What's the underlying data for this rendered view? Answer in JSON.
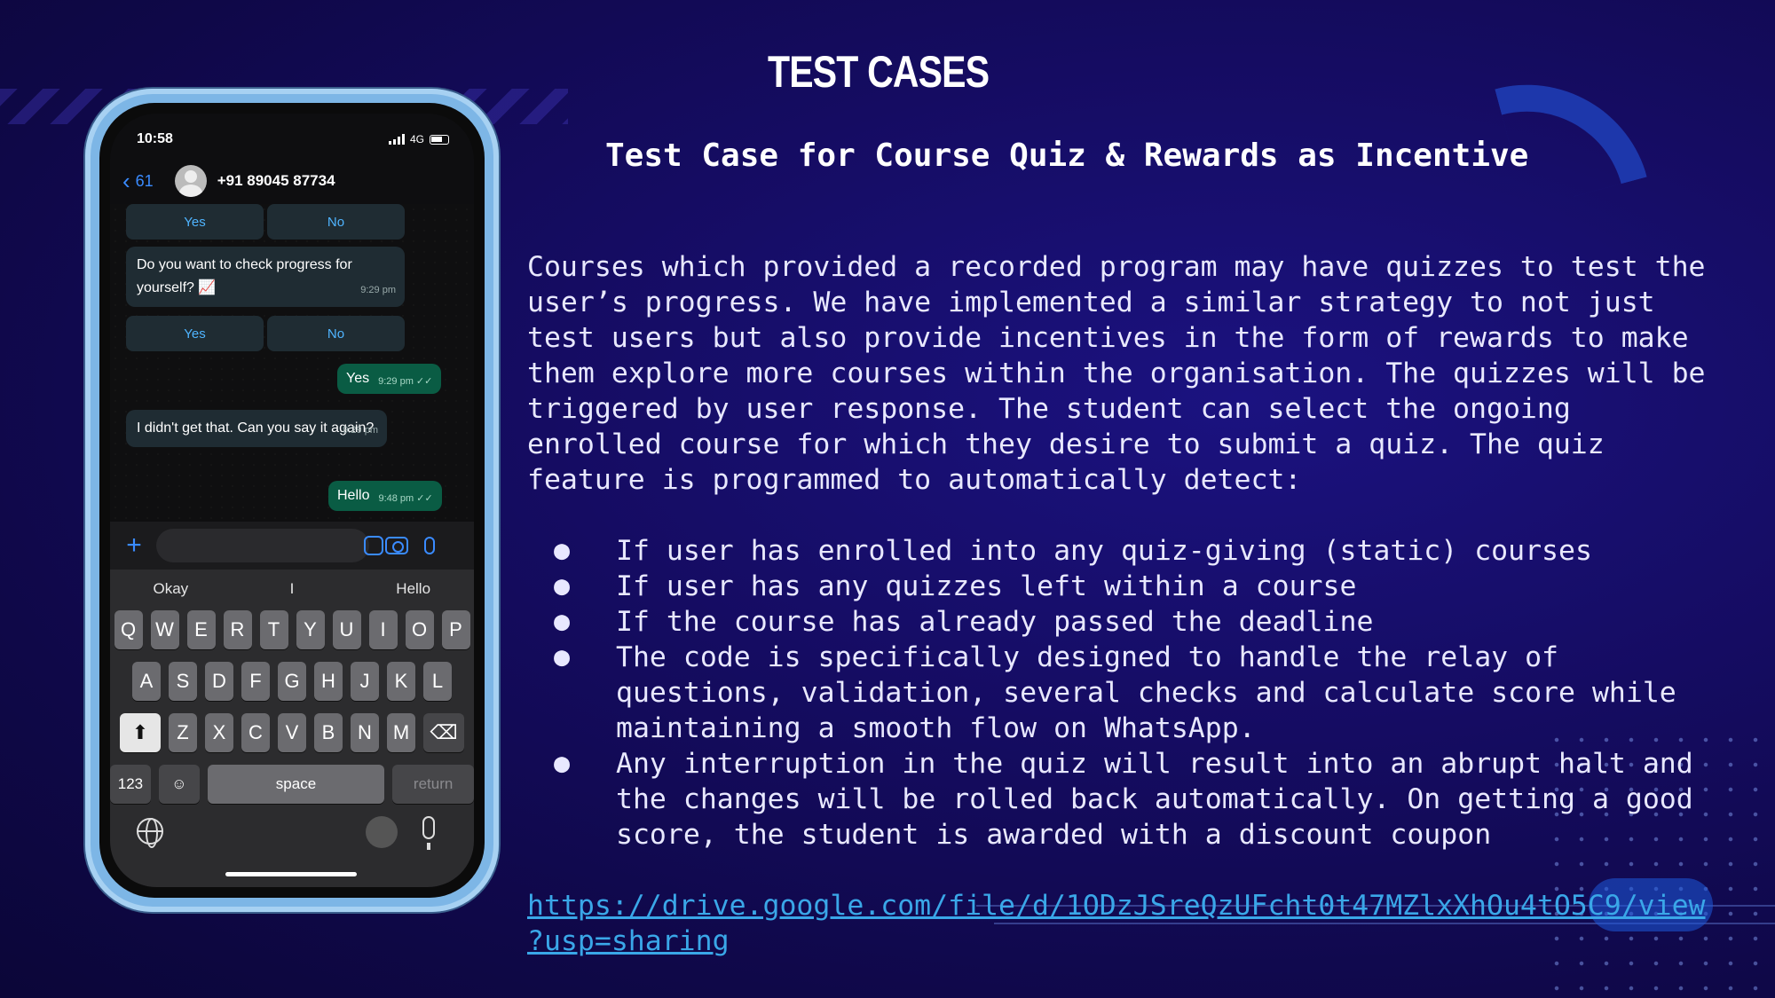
{
  "slide": {
    "title": "TEST CASES",
    "subtitle": "Test Case for Course Quiz & Rewards as Incentive",
    "body": "Courses which provided a recorded program may have quizzes to test the\nuser’s progress. We have implemented a similar strategy to not just\ntest users but also provide incentives in the form of rewards to make\nthem explore more courses within the organisation. The quizzes will be\ntriggered by user response. The student can select the ongoing\nenrolled course for which they desire to submit a quiz. The quiz\nfeature is programmed to automatically detect:",
    "bullet_char": "●",
    "bullets": [
      "If user has enrolled into any quiz-giving (static) courses",
      "If user has any quizzes left within a course",
      "If the course has already passed the deadline",
      "The code is specifically designed to handle the relay of\nquestions, validation, several checks and calculate score while\nmaintaining a smooth flow on WhatsApp.",
      "Any interruption in the quiz will result into an abrupt halt and\nthe changes will be rolled back automatically. On getting a good\nscore, the student is awarded with a discount coupon"
    ],
    "link_text": "https://drive.google.com/file/d/1ODzJSreQzUFcht0t47MZlxXhOu4tO5C9/view\n?usp=sharing"
  },
  "phone": {
    "time": "10:58",
    "network": "4G",
    "back_count": "61",
    "contact": "+91 89045 87734",
    "quick_replies_1": [
      "Yes",
      "No"
    ],
    "msg_progress": "Do you want to check progress for yourself? 📈",
    "msg_progress_time": "9:29 pm",
    "quick_replies_2": [
      "Yes",
      "No"
    ],
    "reply_yes": "Yes",
    "reply_yes_time": "9:29 pm ✓✓",
    "msg_didnt_get": "I didn't get that. Can you say it again?",
    "msg_didnt_get_time": "9:29 pm",
    "reply_hello": "Hello",
    "reply_hello_time": "9:48 pm ✓✓",
    "suggestions": [
      "Okay",
      "I",
      "Hello"
    ],
    "keys_row1": [
      "Q",
      "W",
      "E",
      "R",
      "T",
      "Y",
      "U",
      "I",
      "O",
      "P"
    ],
    "keys_row2": [
      "A",
      "S",
      "D",
      "F",
      "G",
      "H",
      "J",
      "K",
      "L"
    ],
    "keys_row3": [
      "Z",
      "X",
      "C",
      "V",
      "B",
      "N",
      "M"
    ],
    "shift_key": "⬆",
    "delete_key": "⌫",
    "num_key": "123",
    "emoji_key": "☺",
    "space_key": "space",
    "return_key": "return"
  },
  "colors": {
    "background": "#150c62",
    "link": "#3aa7e8",
    "phone_frame": "#7db6e6",
    "wa_outgoing": "#0a5c44",
    "wa_incoming": "#1f2c33"
  }
}
